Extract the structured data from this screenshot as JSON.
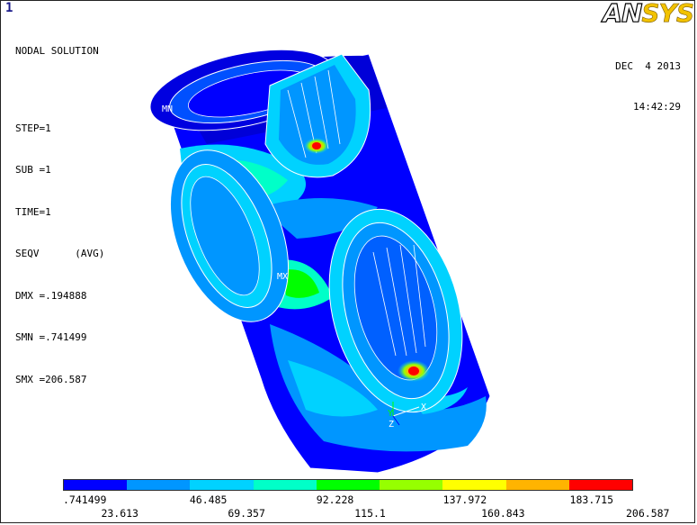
{
  "window": {
    "number": "1"
  },
  "header": {
    "title": "NODAL SOLUTION",
    "lines": [
      "STEP=1",
      "SUB =1",
      "TIME=1",
      "SEQV      (AVG)",
      "DMX =.194888",
      "SMN =.741499",
      "SMX =206.587"
    ]
  },
  "logo": {
    "part1": "AN",
    "part2": "SYS"
  },
  "timestamp": {
    "date": "DEC  4 2013",
    "time": "14:42:29"
  },
  "markers": {
    "min": "MN",
    "max": "MX",
    "axis_x": "X",
    "axis_y": "Y",
    "axis_z": "Z"
  },
  "legend": {
    "colors": [
      "#0000ff",
      "#0096ff",
      "#00d2ff",
      "#00ffc8",
      "#00ff00",
      "#96ff00",
      "#ffff00",
      "#ffb400",
      "#ff0000"
    ],
    "top_ticks": [
      ".741499",
      "46.485",
      "92.228",
      "137.972",
      "183.715"
    ],
    "bottom_ticks": [
      "23.613",
      "69.357",
      "115.1",
      "160.843",
      "206.587"
    ]
  }
}
